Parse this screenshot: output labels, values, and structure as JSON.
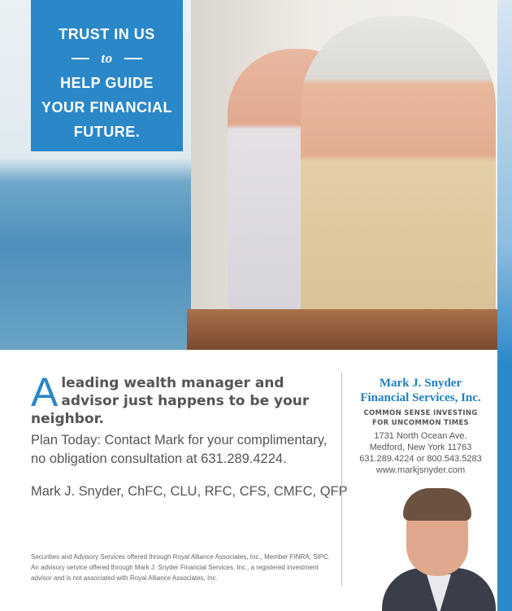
{
  "hero": {
    "line1": "TRUST IN US",
    "to": "to",
    "line2": "HELP GUIDE",
    "line3": "YOUR FINANCIAL",
    "line4": "FUTURE."
  },
  "headline": {
    "drop_cap": "A",
    "text": "leading wealth manager and advisor just happens to be your neighbor."
  },
  "plan": "Plan Today: Contact Mark for your complimentary, no obligation consultation at 631.289.4224.",
  "credentials": "Mark J. Snyder, ChFC, CLU, RFC, CFS, CMFC, QFP",
  "legal": "Securities and Advisory Services offered through Royal Alliance Associates, Inc., Member FINRA, SIPC. An advisory service offered through Mark J. Snyder Financial Services, Inc., a registered investment advisor and is not associated with Royal Alliance Associates, Inc.",
  "firm": {
    "name1": "Mark J. Snyder",
    "name2": "Financial Services, Inc.",
    "tag1": "COMMON SENSE INVESTING",
    "tag2": "FOR UNCOMMON TIMES",
    "address1": "1731 North Ocean Ave.",
    "address2": "Medford, New York 11763",
    "phones": "631.289.4224 or 800.543.5283",
    "website": "www.markjsnyder.com"
  },
  "colors": {
    "brand_blue": "#2a87c8",
    "firm_blue": "#1f7fc1"
  }
}
